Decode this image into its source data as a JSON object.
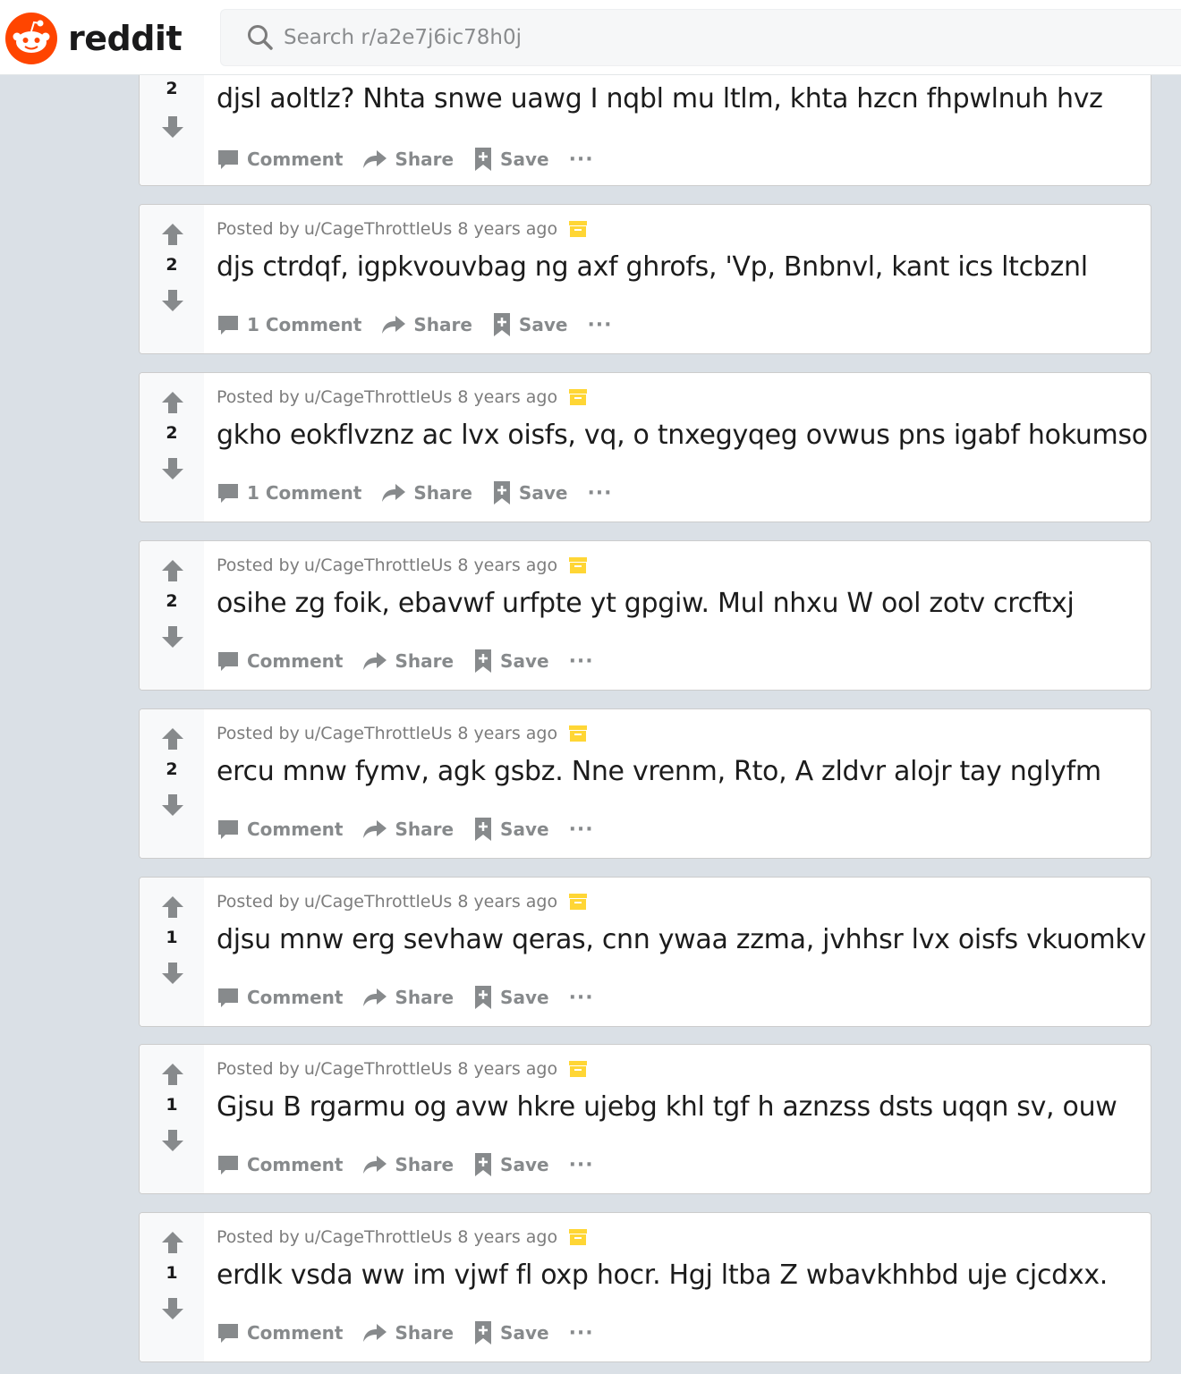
{
  "header": {
    "brand": "reddit",
    "search_placeholder": "Search r/a2e7j6ic78h0j"
  },
  "action_labels": {
    "share": "Share",
    "save": "Save",
    "more": "···"
  },
  "posts": [
    {
      "score": "2",
      "posted_by": "",
      "author": "",
      "time": "",
      "title": "djsl aoltlz? Nhta snwe uawg I nqbl mu ltlm, khta hzcn fhpwlnuh hvz",
      "comments": "Comment"
    },
    {
      "score": "2",
      "posted_by": "Posted by",
      "author": "u/CageThrottleUs",
      "time": "8 years ago",
      "title": "djs ctrdqf, igpkvouvbag ng axf ghrofs, 'Vp, Bnbnvl, kant ics ltcbznl",
      "comments": "1 Comment"
    },
    {
      "score": "2",
      "posted_by": "Posted by",
      "author": "u/CageThrottleUs",
      "time": "8 years ago",
      "title": "gkho eokflvznz ac lvx oisfs, vq, o tnxegyqeg ovwus pns igabf hokumso",
      "comments": "1 Comment"
    },
    {
      "score": "2",
      "posted_by": "Posted by",
      "author": "u/CageThrottleUs",
      "time": "8 years ago",
      "title": "osihe zg foik, ebavwf urfpte yt gpgiw. Mul nhxu W ool zotv crcftxj",
      "comments": "Comment"
    },
    {
      "score": "2",
      "posted_by": "Posted by",
      "author": "u/CageThrottleUs",
      "time": "8 years ago",
      "title": "ercu mnw fymv, agk gsbz. Nne vrenm, Rto, A zldvr alojr tay nglyfm",
      "comments": "Comment"
    },
    {
      "score": "1",
      "posted_by": "Posted by",
      "author": "u/CageThrottleUs",
      "time": "8 years ago",
      "title": "djsu mnw erg sevhaw qeras, cnn ywaa zzma, jvhhsr lvx oisfs vkuomkv",
      "comments": "Comment"
    },
    {
      "score": "1",
      "posted_by": "Posted by",
      "author": "u/CageThrottleUs",
      "time": "8 years ago",
      "title": "Gjsu B rgarmu og avw hkre ujebg khl tgf h aznzss dsts uqqn sv, ouw",
      "comments": "Comment"
    },
    {
      "score": "1",
      "posted_by": "Posted by",
      "author": "u/CageThrottleUs",
      "time": "8 years ago",
      "title": "erdlk vsda ww im vjwf fl oxp hocr. Hgj ltba Z wbavkhhbd uje cjcdxx.",
      "comments": "Comment"
    }
  ],
  "icons": {
    "upvote": "arrow-up-icon",
    "downvote": "arrow-down-icon",
    "comment": "comment-bubble-icon",
    "share": "share-arrow-icon",
    "save": "bookmark-plus-icon",
    "archive": "archive-box-icon"
  },
  "colors": {
    "brand": "#ff4500",
    "archive": "#ffd635",
    "page_bg": "#dae0e6"
  }
}
